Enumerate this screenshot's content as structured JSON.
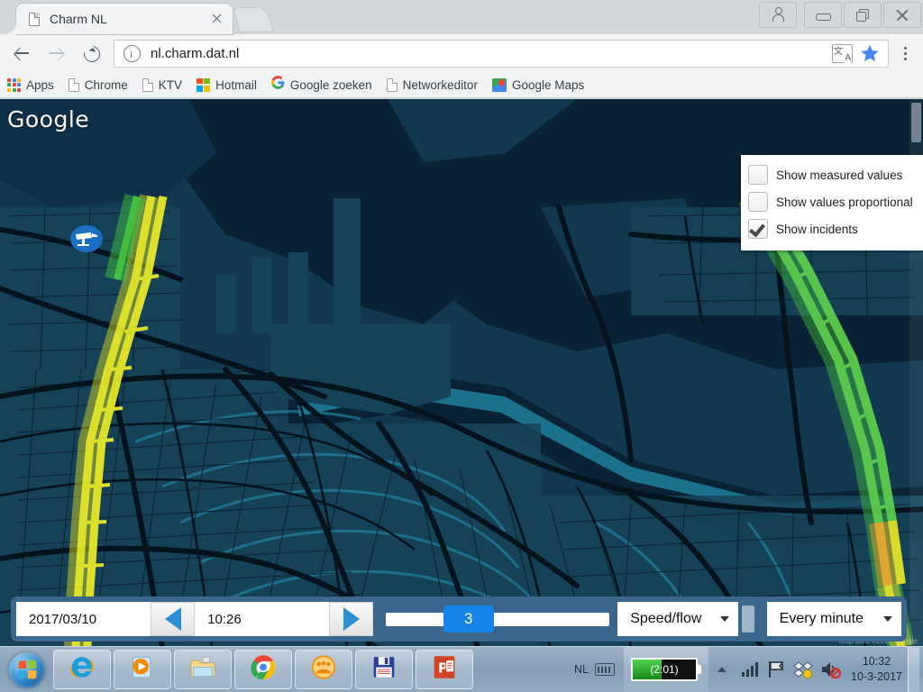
{
  "browser": {
    "tab": {
      "title": "Charm NL",
      "favicon_icon": "page-icon",
      "close_icon": "close-icon"
    },
    "window_controls": {
      "profile_icon": "person-icon",
      "minimize_icon": "minimize-icon",
      "restore_icon": "restore-icon",
      "close_icon": "close-icon"
    },
    "nav": {
      "back_icon": "back-arrow-icon",
      "forward_icon": "forward-arrow-icon",
      "reload_icon": "reload-icon",
      "menu_icon": "three-dots-menu-icon"
    },
    "omnibox": {
      "url": "nl.charm.dat.nl",
      "info_icon": "site-info-icon",
      "translate_icon": "translate-icon",
      "bookmark_icon": "star-icon",
      "bookmark_color": "#4285f4"
    },
    "bookmarks": [
      {
        "label": "Apps",
        "icon": "apps-grid-icon"
      },
      {
        "label": "Chrome",
        "icon": "page-icon"
      },
      {
        "label": "KTV",
        "icon": "page-icon"
      },
      {
        "label": "Hotmail",
        "icon": "microsoft-logo-icon"
      },
      {
        "label": "Google zoeken",
        "icon": "google-g-icon"
      },
      {
        "label": "Networkeditor",
        "icon": "page-icon"
      },
      {
        "label": "Google Maps",
        "icon": "google-maps-icon"
      }
    ]
  },
  "map": {
    "provider_logo": "Google",
    "attribution": "Map data ©2017 Google",
    "incident_marker_icon": "traffic-camera-icon",
    "colors": {
      "water": "#0a2233",
      "land": "#123850",
      "road": "#06131d",
      "canal": "#17708c",
      "traffic_yellow": "#e8e82a",
      "traffic_green": "#45c23a",
      "traffic_orange": "#e8a024",
      "marker_blue": "#1a6fc4"
    }
  },
  "panel": {
    "options": [
      {
        "label": "Show measured values",
        "checked": false
      },
      {
        "label": "Show values proportional",
        "checked": false
      },
      {
        "label": "Show incidents",
        "checked": true
      }
    ]
  },
  "controlbar": {
    "date": "2017/03/10",
    "time": "10:26",
    "prev_icon": "previous-triangle-icon",
    "next_icon": "next-triangle-icon",
    "slider_value": "3",
    "slider_percent": 33,
    "metric": {
      "label": "Speed/flow",
      "caret_icon": "chevron-down-icon"
    },
    "interval": {
      "label": "Every minute",
      "caret_icon": "chevron-down-icon"
    }
  },
  "taskbar": {
    "start_label": "Start",
    "buttons": [
      {
        "name": "internet-explorer",
        "icon": "internet-explorer-icon"
      },
      {
        "name": "windows-media-player",
        "icon": "media-player-icon"
      },
      {
        "name": "file-explorer",
        "icon": "folder-icon"
      },
      {
        "name": "google-chrome",
        "icon": "chrome-icon"
      },
      {
        "name": "teamviewer",
        "icon": "teamviewer-icon"
      },
      {
        "name": "save-app",
        "icon": "floppy-disk-icon"
      },
      {
        "name": "powerpoint",
        "icon": "powerpoint-icon"
      }
    ],
    "tray": {
      "language": "NL",
      "keyboard_icon": "keyboard-icon",
      "battery_text": "(2:01)",
      "battery_percent": 46,
      "show_hidden_icon": "chevron-up-icon",
      "network_icon": "network-bars-icon",
      "action_center_icon": "flag-icon",
      "dropbox_icon": "dropbox-icon",
      "volume_icon": "volume-muted-icon",
      "time": "10:32",
      "date": "10-3-2017"
    }
  }
}
